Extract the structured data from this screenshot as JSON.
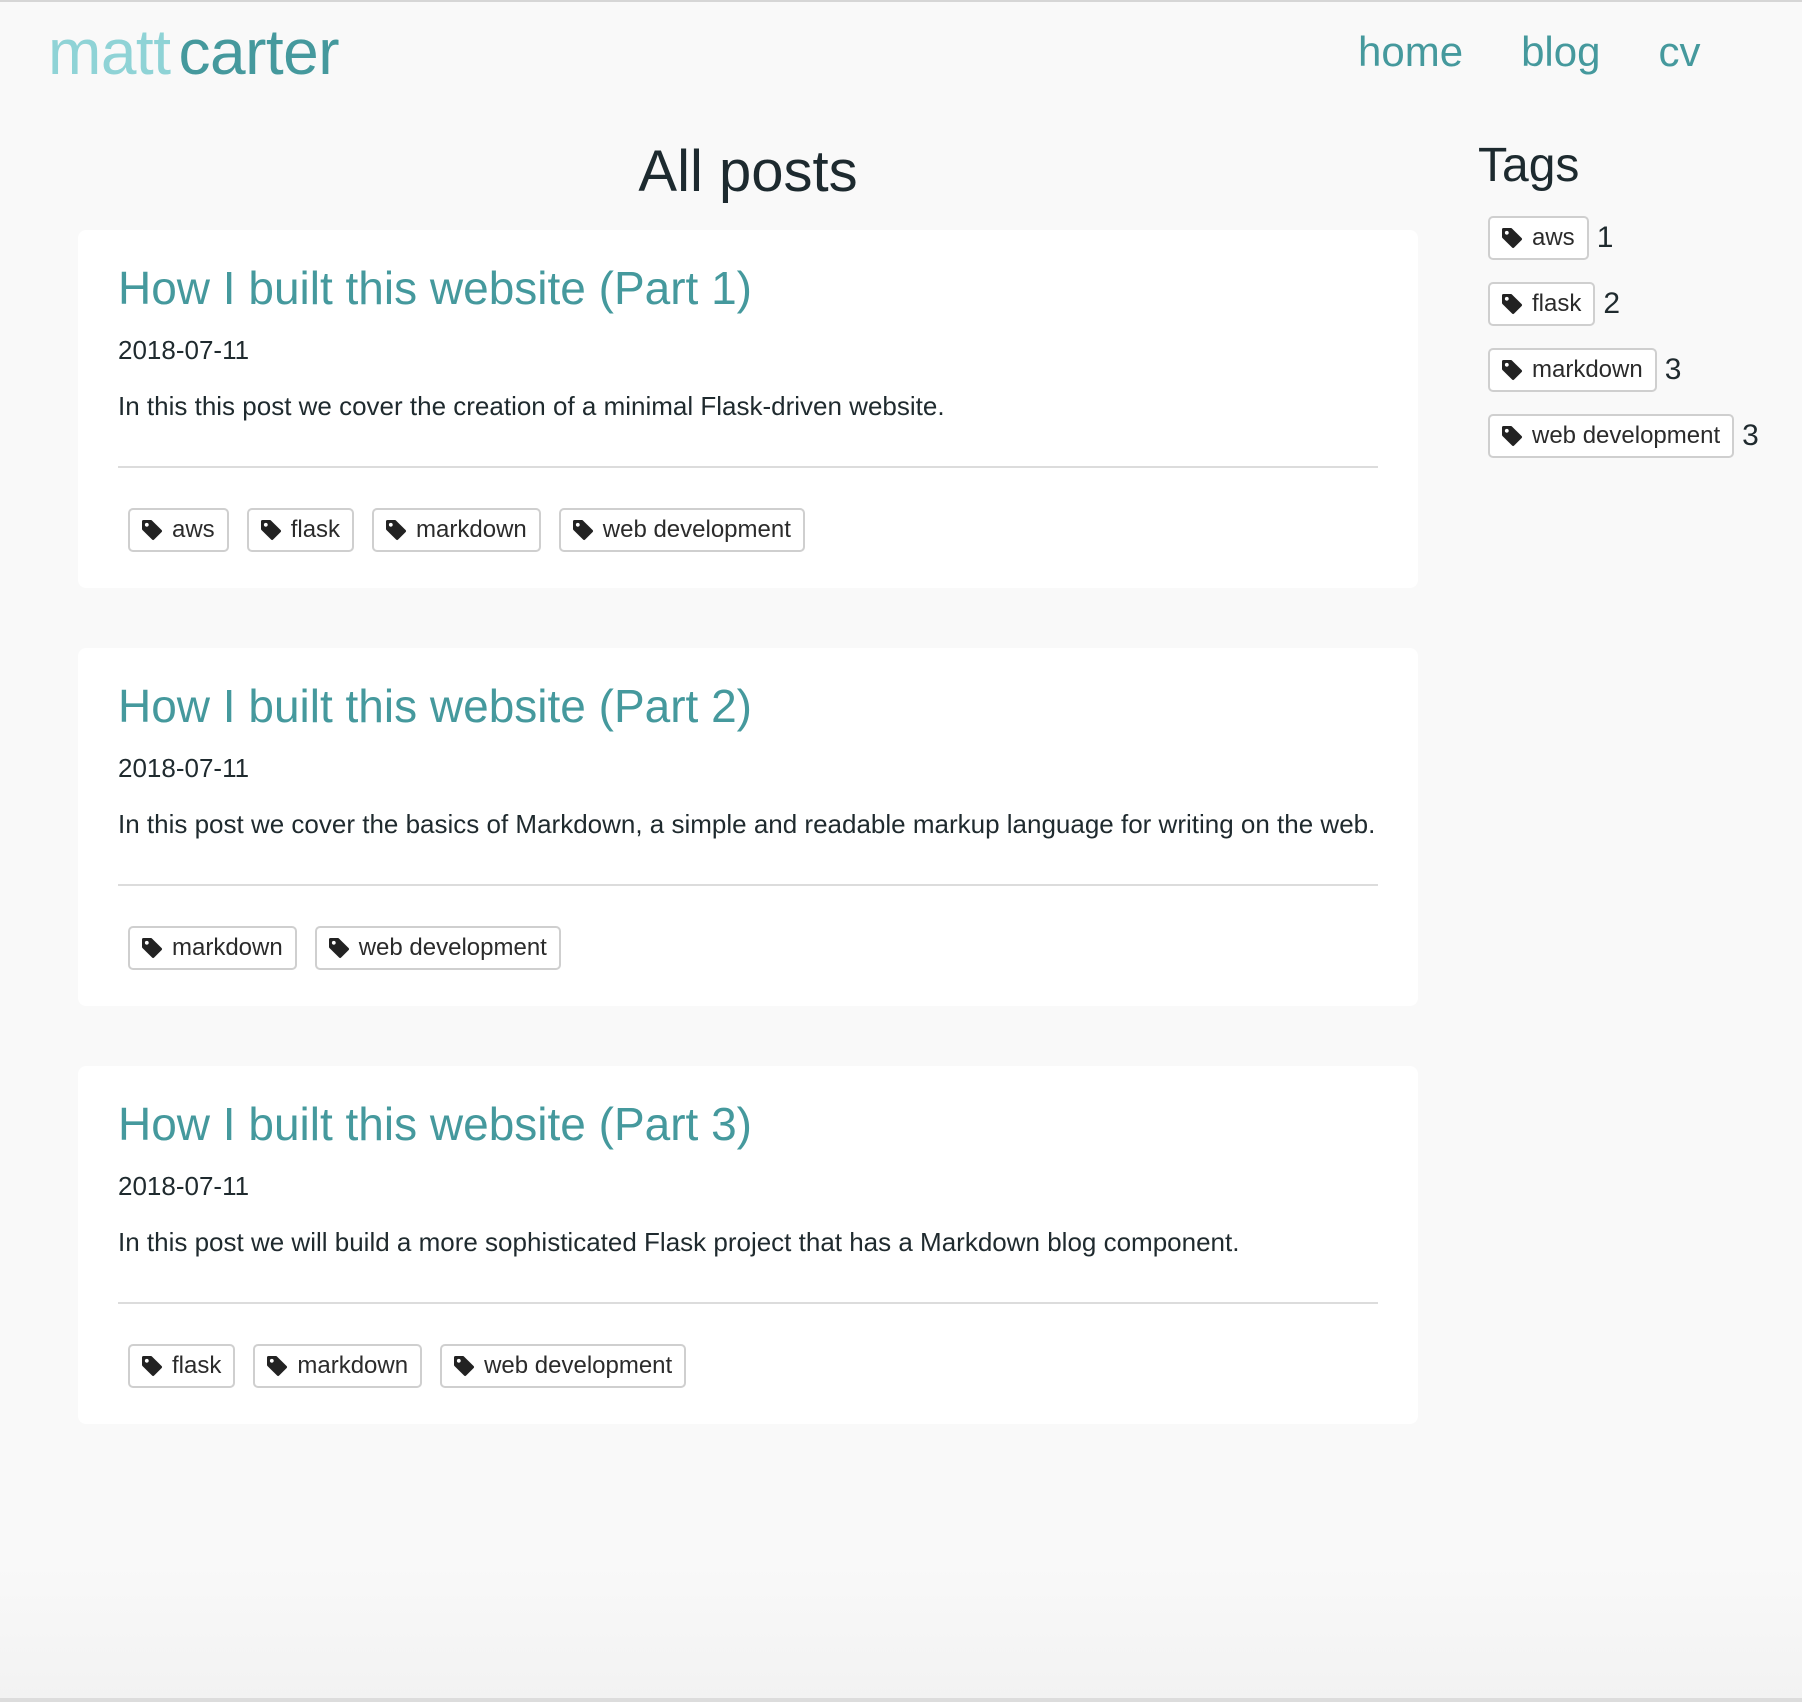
{
  "brand": {
    "first": "matt",
    "last": "carter"
  },
  "nav": {
    "home": "home",
    "blog": "blog",
    "cv": "cv"
  },
  "main": {
    "title": "All posts"
  },
  "posts": [
    {
      "title": "How I built this website (Part 1)",
      "date": "2018-07-11",
      "excerpt": "In this this post we cover the creation of a minimal Flask-driven website.",
      "tags": [
        "aws",
        "flask",
        "markdown",
        "web development"
      ]
    },
    {
      "title": "How I built this website (Part 2)",
      "date": "2018-07-11",
      "excerpt": "In this post we cover the basics of Markdown, a simple and readable markup language for writing on the web.",
      "tags": [
        "markdown",
        "web development"
      ]
    },
    {
      "title": "How I built this website (Part 3)",
      "date": "2018-07-11",
      "excerpt": "In this post we will build a more sophisticated Flask project that has a Markdown blog component.",
      "tags": [
        "flask",
        "markdown",
        "web development"
      ]
    }
  ],
  "sidebar": {
    "title": "Tags",
    "tags": [
      {
        "label": "aws",
        "count": "1"
      },
      {
        "label": "flask",
        "count": "2"
      },
      {
        "label": "markdown",
        "count": "3"
      },
      {
        "label": "web development",
        "count": "3"
      }
    ]
  },
  "icons": {
    "tag": "tag-icon"
  },
  "colors": {
    "accent": "#45999d",
    "brand_light": "#8fd3d6",
    "text": "#1f2a2e",
    "background": "#f9f9f9"
  }
}
